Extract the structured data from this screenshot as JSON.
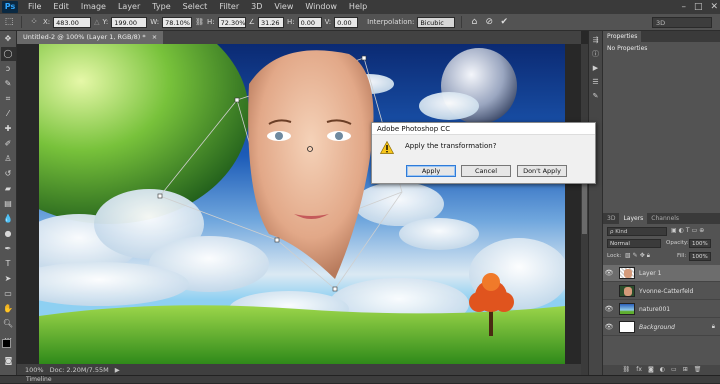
{
  "app": {
    "logo": "Ps"
  },
  "menu": [
    "File",
    "Edit",
    "Image",
    "Layer",
    "Type",
    "Select",
    "Filter",
    "3D",
    "View",
    "Window",
    "Help"
  ],
  "window_controls": [
    "–",
    "□",
    "✕"
  ],
  "options": {
    "x_label": "X:",
    "x_value": "483.00 px",
    "y_label": "Y:",
    "y_value": "199.00 px",
    "w_label": "W:",
    "w_value": "78.10%",
    "h_label": "H:",
    "h_value": "72.30%",
    "rot_label": "∠",
    "rot_value": "31.26",
    "hskew_label": "H:",
    "hskew_value": "0.00",
    "vskew_label": "V:",
    "vskew_value": "0.00",
    "interp_label": "Interpolation:",
    "interp_value": "Bicubic",
    "workspace_value": "3D"
  },
  "document": {
    "tab_title": "Untitled-2 @ 100% (Layer 1, RGB/8) *",
    "zoom": "100%",
    "doc_info": "Doc: 2.20M/7.55M"
  },
  "bottom": {
    "timeline": "Timeline"
  },
  "properties": {
    "tab": "Properties",
    "message": "No Properties"
  },
  "layers_panel": {
    "tabs": [
      "3D",
      "Layers",
      "Channels"
    ],
    "kind_label": "ρ Kind",
    "blend_mode": "Normal",
    "opacity_label": "Opacity:",
    "opacity_value": "100%",
    "lock_label": "Lock:",
    "fill_label": "Fill:",
    "fill_value": "100%",
    "layers": [
      {
        "name": "Layer 1",
        "visible": true,
        "selected": true
      },
      {
        "name": "Yvonne-Catterfeld",
        "visible": false,
        "selected": false
      },
      {
        "name": "nature001",
        "visible": true,
        "selected": false
      },
      {
        "name": "Background",
        "visible": true,
        "selected": false,
        "locked": true
      }
    ],
    "footer_icons": [
      "link-icon",
      "fx-icon",
      "mask-icon",
      "adjustment-icon",
      "folder-icon",
      "new-layer-icon",
      "trash-icon"
    ]
  },
  "dialog": {
    "title": "Adobe Photoshop CC",
    "message": "Apply the transformation?",
    "apply": "Apply",
    "cancel": "Cancel",
    "dont_apply": "Don't Apply"
  },
  "colors": {
    "dialog_default_border": "#2f7bd8",
    "selected_layer": "#6d6d6d"
  }
}
